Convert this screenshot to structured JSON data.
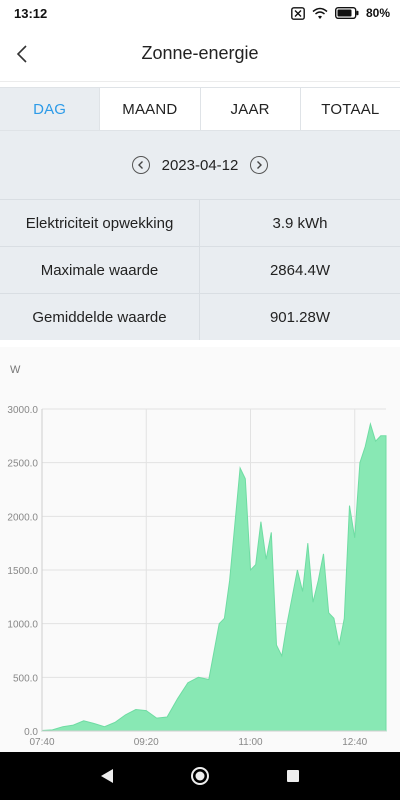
{
  "status_bar": {
    "time": "13:12",
    "battery": "80%",
    "icons": [
      "notification-muted-icon",
      "wifi-icon",
      "battery-icon"
    ]
  },
  "header": {
    "title": "Zonne-energie",
    "back_icon": "chevron-left-icon"
  },
  "tabs": [
    {
      "label": "DAG",
      "active": true
    },
    {
      "label": "MAAND",
      "active": false
    },
    {
      "label": "JAAR",
      "active": false
    },
    {
      "label": "TOTAAL",
      "active": false
    }
  ],
  "date_selector": {
    "date": "2023-04-12",
    "prev_icon": "chevron-left-circle-icon",
    "next_icon": "chevron-right-circle-icon"
  },
  "stats": [
    {
      "label": "Elektriciteit opwekking",
      "value": "3.9 kWh"
    },
    {
      "label": "Maximale waarde",
      "value": "2864.4W"
    },
    {
      "label": "Gemiddelde waarde",
      "value": "901.28W"
    }
  ],
  "colors": {
    "accent": "#2d9be8",
    "area_fill": "#88e8b4",
    "area_stroke": "#6fdca3",
    "panel_bg": "#e9edf1"
  },
  "chart_data": {
    "type": "area",
    "ylabel": "W",
    "ylim": [
      0,
      3000
    ],
    "y_ticks": [
      "3000.0",
      "2500.0",
      "2000.0",
      "1500.0",
      "1000.0",
      "500.0",
      "0.0"
    ],
    "x_ticks": [
      "07:40",
      "09:20",
      "11:00",
      "12:40"
    ],
    "grid": true,
    "x": [
      "07:40",
      "07:50",
      "08:00",
      "08:10",
      "08:20",
      "08:30",
      "08:40",
      "08:50",
      "09:00",
      "09:10",
      "09:20",
      "09:30",
      "09:40",
      "09:50",
      "10:00",
      "10:10",
      "10:20",
      "10:30",
      "10:35",
      "10:40",
      "10:50",
      "10:55",
      "11:00",
      "11:05",
      "11:10",
      "11:15",
      "11:20",
      "11:25",
      "11:30",
      "11:35",
      "11:40",
      "11:45",
      "11:50",
      "11:55",
      "12:00",
      "12:05",
      "12:10",
      "12:15",
      "12:20",
      "12:25",
      "12:30",
      "12:35",
      "12:40",
      "12:45",
      "12:50",
      "12:55",
      "13:00",
      "13:05",
      "13:10"
    ],
    "series": [
      {
        "values": [
          5,
          10,
          40,
          55,
          95,
          70,
          40,
          80,
          150,
          200,
          190,
          120,
          130,
          300,
          450,
          500,
          480,
          1000,
          1050,
          1400,
          2450,
          2350,
          1500,
          1550,
          1950,
          1600,
          1850,
          800,
          700,
          1000,
          1250,
          1500,
          1300,
          1750,
          1200,
          1400,
          1650,
          1100,
          1050,
          800,
          1050,
          2100,
          1800,
          2500,
          2650,
          2860,
          2700,
          2750,
          2750
        ]
      }
    ]
  },
  "nav_bar": {
    "back_icon": "triangle-back-icon",
    "home_icon": "circle-home-icon",
    "recents_icon": "square-recents-icon"
  }
}
